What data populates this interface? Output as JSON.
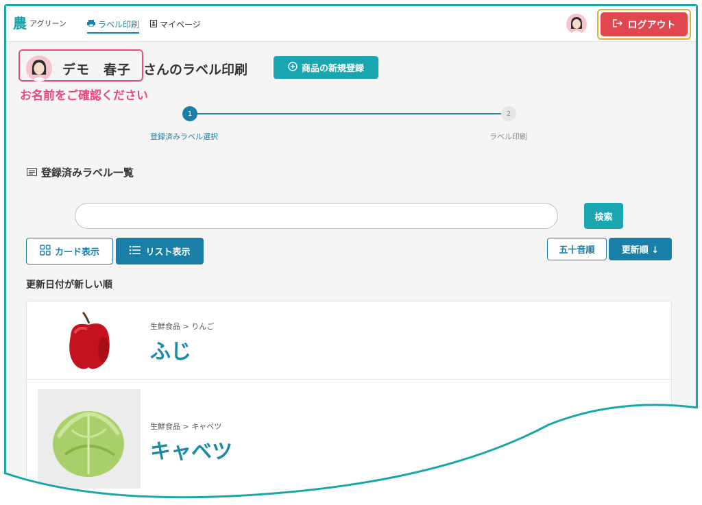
{
  "header": {
    "logo_mark": "農",
    "logo_text": "アグリーン",
    "nav": [
      {
        "label": "ラベル印刷",
        "icon": "printer-icon",
        "active": true
      },
      {
        "label": "マイページ",
        "icon": "id-card-icon",
        "active": false
      }
    ],
    "logout_label": "ログアウト",
    "logout_color": "#e0474e"
  },
  "user": {
    "name": "デモ　春子",
    "suffix": "さんのラベル印刷",
    "confirm_note": "お名前をご確認ください"
  },
  "new_product_label": "商品の新規登録",
  "stepper": {
    "steps": [
      {
        "number": "1",
        "label": "登録済みラベル選択",
        "active": true
      },
      {
        "number": "2",
        "label": "ラベル印刷",
        "active": false
      }
    ]
  },
  "list": {
    "heading": "登録済みラベル一覧",
    "search": {
      "value": "",
      "placeholder": "",
      "button_label": "検索"
    },
    "view_modes": [
      {
        "label": "カード表示",
        "icon": "grid-icon",
        "active": false
      },
      {
        "label": "リスト表示",
        "icon": "list-icon",
        "active": true
      }
    ],
    "sort_options": [
      {
        "label": "五十音順",
        "active": false
      },
      {
        "label": "更新順 ↓",
        "active": true
      }
    ],
    "sort_caption": "更新日付が新しい順",
    "items": [
      {
        "category": "生鮮食品 > りんご",
        "name": "ふじ",
        "image": "apple"
      },
      {
        "category": "生鮮食品 > キャベツ",
        "name": "キャベツ",
        "image": "cabbage"
      }
    ]
  },
  "colors": {
    "accent": "#1a7fa6",
    "teal": "#1aa6b0",
    "highlight_pink": "#e84a8a",
    "highlight_gold": "#e0b030"
  }
}
